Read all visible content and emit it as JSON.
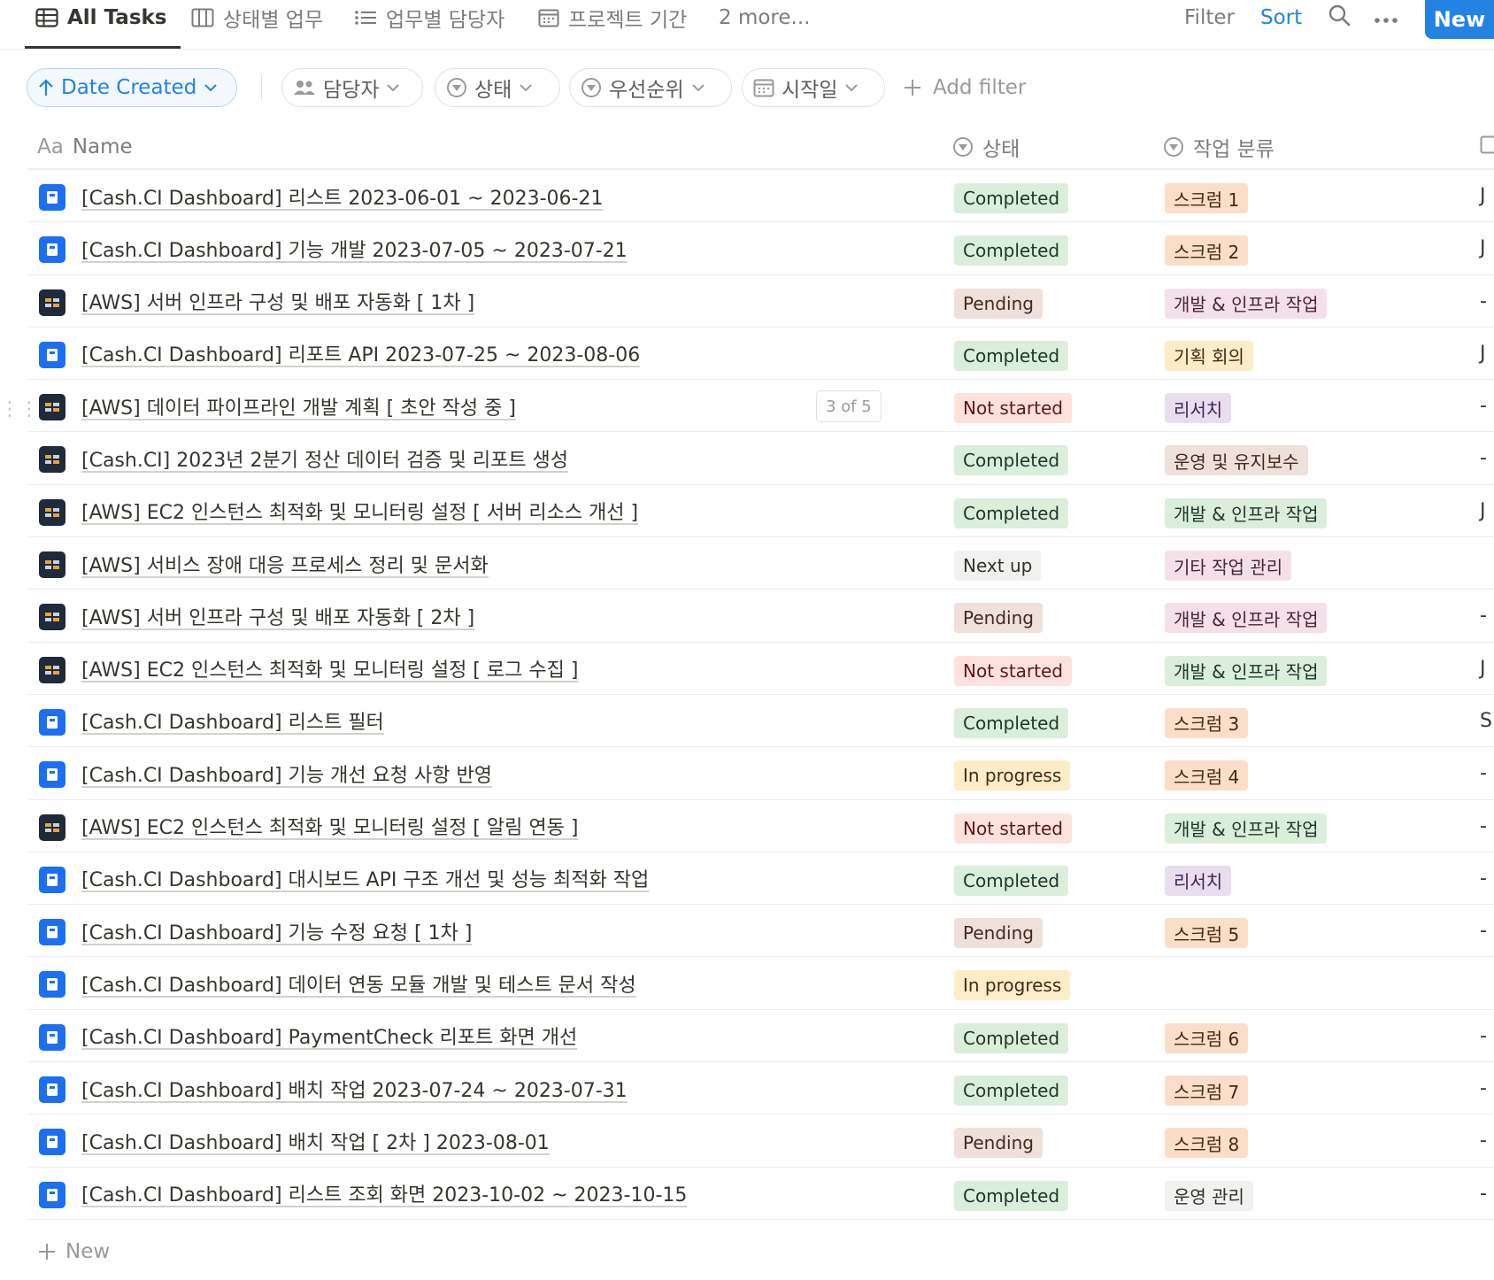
{
  "views": {
    "tabs": [
      {
        "label": "All Tasks",
        "icon": "table-icon",
        "active": true
      },
      {
        "label": "상태별 업무",
        "icon": "board-icon",
        "active": false
      },
      {
        "label": "업무별 담당자",
        "icon": "list-icon",
        "active": false
      },
      {
        "label": "프로젝트 기간",
        "icon": "calendar-icon",
        "active": false
      }
    ],
    "more_label": "2 more..."
  },
  "toolbar": {
    "filter_label": "Filter",
    "sort_label": "Sort",
    "new_label": "New"
  },
  "filters": {
    "sort_chip": "Date Created",
    "chips": [
      {
        "label": "담당자",
        "icon": "people-icon"
      },
      {
        "label": "상태",
        "icon": "status-icon"
      },
      {
        "label": "우선순위",
        "icon": "status-icon"
      },
      {
        "label": "시작일",
        "icon": "calendar-icon"
      }
    ],
    "add_filter_label": "Add filter"
  },
  "table": {
    "columns": {
      "name": "Name",
      "name_prefix": "Aa",
      "status": "상태",
      "category": "작업 분류"
    },
    "new_row_label": "New",
    "rows": [
      {
        "name": "[Cash.CI Dashboard] 리스트 2023-06-01 ~ 2023-06-21",
        "icon": "blue",
        "status": "Completed",
        "status_color": "#dbeddb",
        "status_text": "#1c3829",
        "category": "스크럼 1",
        "cat_color": "#fadec9",
        "cat_text": "#49290e",
        "edge": "J"
      },
      {
        "name": "[Cash.CI Dashboard] 기능 개발 2023-07-05 ~ 2023-07-21",
        "icon": "blue",
        "status": "Completed",
        "status_color": "#dbeddb",
        "status_text": "#1c3829",
        "category": "스크럼 2",
        "cat_color": "#fadec9",
        "cat_text": "#49290e",
        "edge": "J"
      },
      {
        "name": "[AWS] 서버 인프라 구성 및 배포 자동화 [ 1차 ]",
        "icon": "dark",
        "status": "Pending",
        "status_color": "#eee0da",
        "status_text": "#442a1e",
        "category": "개발 & 인프라 작업",
        "cat_color": "#f5e0e9",
        "cat_text": "#4c2337",
        "edge": "-"
      },
      {
        "name": "[Cash.CI Dashboard] 리포트 API 2023-07-25 ~ 2023-08-06",
        "icon": "blue",
        "status": "Completed",
        "status_color": "#dbeddb",
        "status_text": "#1c3829",
        "category": "기획 회의",
        "cat_color": "#fdecc8",
        "cat_text": "#402c1b",
        "edge": "J"
      },
      {
        "name": "[AWS] 데이터 파이프라인 개발 계획 [ 초안 작성 중 ]",
        "icon": "dark",
        "status": "Not started",
        "status_color": "#ffe2dd",
        "status_text": "#5d1715",
        "category": "리서치",
        "cat_color": "#e8deee",
        "cat_text": "#412454",
        "edge": "-",
        "hover": "3 of 5"
      },
      {
        "name": "[Cash.CI] 2023년 2분기 정산 데이터 검증 및 리포트 생성",
        "icon": "dark",
        "status": "Completed",
        "status_color": "#dbeddb",
        "status_text": "#1c3829",
        "category": "운영 및 유지보수",
        "cat_color": "#eee0da",
        "cat_text": "#442a1e",
        "edge": "-"
      },
      {
        "name": "[AWS] EC2 인스턴스 최적화 및 모니터링 설정 [ 서버 리소스 개선 ]",
        "icon": "dark",
        "status": "Completed",
        "status_color": "#dbeddb",
        "status_text": "#1c3829",
        "category": "개발 & 인프라 작업",
        "cat_color": "#dbeddb",
        "cat_text": "#1c3829",
        "edge": "J"
      },
      {
        "name": "[AWS] 서비스 장애 대응 프로세스 정리 및 문서화",
        "icon": "dark",
        "status": "Next up",
        "status_color": "#f1f1ef",
        "status_text": "#32302c",
        "category": "기타 작업 관리",
        "cat_color": "#f5e0e9",
        "cat_text": "#4c2337",
        "edge": ""
      },
      {
        "name": "[AWS] 서버 인프라 구성 및 배포 자동화 [ 2차 ]",
        "icon": "dark",
        "status": "Pending",
        "status_color": "#eee0da",
        "status_text": "#442a1e",
        "category": "개발 & 인프라 작업",
        "cat_color": "#f5e0e9",
        "cat_text": "#4c2337",
        "edge": "-"
      },
      {
        "name": "[AWS] EC2 인스턴스 최적화 및 모니터링 설정 [ 로그 수집 ]",
        "icon": "dark",
        "status": "Not started",
        "status_color": "#ffe2dd",
        "status_text": "#5d1715",
        "category": "개발 & 인프라 작업",
        "cat_color": "#dbeddb",
        "cat_text": "#1c3829",
        "edge": "J"
      },
      {
        "name": "[Cash.CI Dashboard] 리스트 필터",
        "icon": "blue",
        "status": "Completed",
        "status_color": "#dbeddb",
        "status_text": "#1c3829",
        "category": "스크럼 3",
        "cat_color": "#fadec9",
        "cat_text": "#49290e",
        "edge": "S"
      },
      {
        "name": "[Cash.CI Dashboard] 기능 개선 요청 사항 반영",
        "icon": "blue",
        "status": "In progress",
        "status_color": "#fdecc8",
        "status_text": "#402c1b",
        "category": "스크럼 4",
        "cat_color": "#fadec9",
        "cat_text": "#49290e",
        "edge": "-"
      },
      {
        "name": "[AWS] EC2 인스턴스 최적화 및 모니터링 설정 [ 알림 연동 ]",
        "icon": "dark",
        "status": "Not started",
        "status_color": "#ffe2dd",
        "status_text": "#5d1715",
        "category": "개발 & 인프라 작업",
        "cat_color": "#dbeddb",
        "cat_text": "#1c3829",
        "edge": "-"
      },
      {
        "name": "[Cash.CI Dashboard] 대시보드 API 구조 개선 및 성능 최적화 작업",
        "icon": "blue",
        "status": "Completed",
        "status_color": "#dbeddb",
        "status_text": "#1c3829",
        "category": "리서치",
        "cat_color": "#e8deee",
        "cat_text": "#412454",
        "edge": "-"
      },
      {
        "name": "[Cash.CI Dashboard] 기능 수정 요청 [ 1차 ]",
        "icon": "blue",
        "status": "Pending",
        "status_color": "#eee0da",
        "status_text": "#442a1e",
        "category": "스크럼 5",
        "cat_color": "#fadec9",
        "cat_text": "#49290e",
        "edge": "-"
      },
      {
        "name": "[Cash.CI Dashboard] 데이터 연동 모듈 개발 및 테스트 문서 작성",
        "icon": "blue",
        "status": "In progress",
        "status_color": "#fdecc8",
        "status_text": "#402c1b",
        "category": "",
        "cat_color": "",
        "cat_text": "",
        "edge": ""
      },
      {
        "name": "[Cash.CI Dashboard] PaymentCheck 리포트 화면 개선",
        "icon": "blue",
        "status": "Completed",
        "status_color": "#dbeddb",
        "status_text": "#1c3829",
        "category": "스크럼 6",
        "cat_color": "#fadec9",
        "cat_text": "#49290e",
        "edge": "-"
      },
      {
        "name": "[Cash.CI Dashboard] 배치 작업 2023-07-24 ~ 2023-07-31",
        "icon": "blue",
        "status": "Completed",
        "status_color": "#dbeddb",
        "status_text": "#1c3829",
        "category": "스크럼 7",
        "cat_color": "#fadec9",
        "cat_text": "#49290e",
        "edge": "-"
      },
      {
        "name": "[Cash.CI Dashboard] 배치 작업 [ 2차 ] 2023-08-01",
        "icon": "blue",
        "status": "Pending",
        "status_color": "#eee0da",
        "status_text": "#442a1e",
        "category": "스크럼 8",
        "cat_color": "#fadec9",
        "cat_text": "#49290e",
        "edge": "-"
      },
      {
        "name": "[Cash.CI Dashboard] 리스트 조회 화면 2023-10-02 ~ 2023-10-15",
        "icon": "blue",
        "status": "Completed",
        "status_color": "#dbeddb",
        "status_text": "#1c3829",
        "category": "운영 관리",
        "cat_color": "#f1f1ef",
        "cat_text": "#32302c",
        "edge": "-"
      }
    ]
  },
  "colors": {
    "accent": "#2383e2",
    "project_blue": "#1d6ff2",
    "project_dark": "#1f2a3a"
  }
}
